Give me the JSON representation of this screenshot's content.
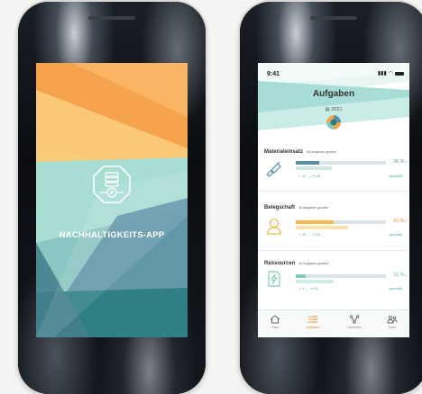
{
  "splash": {
    "title": "NACHHALTIGKEITS-APP",
    "logo_icon": "server-compass-icon",
    "colors": {
      "orange": "#f7a04a",
      "yellow": "#f9c86e",
      "teal_light": "#a9ddd4",
      "teal_mid": "#7fb8b8",
      "teal_dark": "#2d7e83",
      "blue_grey": "#5b8fa6"
    }
  },
  "app": {
    "status_time": "9:41",
    "title": "Aufgaben",
    "year": "2021",
    "sections": [
      {
        "title": "Materialeinsatz",
        "subtitle": "46 Aufgaben gesamt",
        "icon": "hand-brush-icon",
        "percent_label": "26 %",
        "progress": 0.26,
        "done": "12",
        "open": "20",
        "link": "geschafft",
        "color": "#5a8fa8"
      },
      {
        "title": "Belegschaft",
        "subtitle": "46 Aufgaben gesamt",
        "icon": "person-icon",
        "percent_label": "42 %",
        "progress": 0.42,
        "done": "20",
        "open": "16",
        "link": "geschafft",
        "color": "#f5b955"
      },
      {
        "title": "Ressourcen",
        "subtitle": "45 Aufgaben gesamt",
        "icon": "energy-document-icon",
        "percent_label": "11 %",
        "progress": 0.11,
        "done": "5",
        "open": "20",
        "link": "geschafft",
        "color": "#7fcabc"
      }
    ],
    "tabs": [
      {
        "label": "Start",
        "icon": "home-icon"
      },
      {
        "label": "Aufgaben",
        "icon": "list-icon"
      },
      {
        "label": "Übersicht",
        "icon": "network-icon"
      },
      {
        "label": "Team",
        "icon": "team-icon"
      }
    ]
  }
}
